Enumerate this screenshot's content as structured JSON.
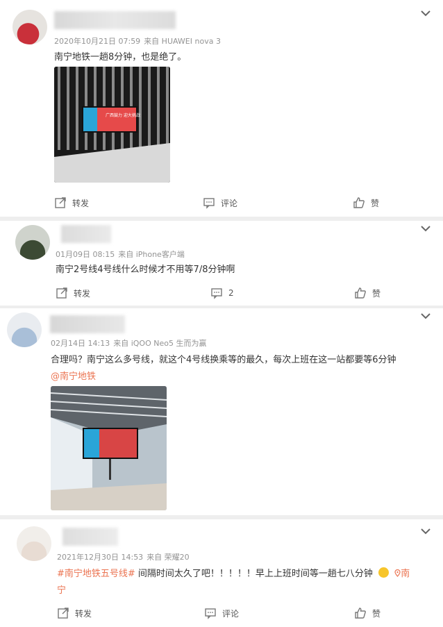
{
  "posts": [
    {
      "meta": {
        "time": "2020年10月21日 07:59",
        "source": "来自 HUAWEI nova 3"
      },
      "text": "南宁地铁一趟8分钟，也是绝了。",
      "image_screen_text": "广西鼓力 迎大挑战",
      "actions": {
        "repost": "转发",
        "comment": "评论",
        "like": "赞"
      }
    },
    {
      "meta": {
        "time": "01月09日 08:15",
        "source": "来自 iPhone客户端"
      },
      "text": "南宁2号线4号线什么时候才不用等7/8分钟啊",
      "actions": {
        "repost": "转发",
        "comment": "2",
        "like": "赞"
      }
    },
    {
      "meta": {
        "time": "02月14日 14:13",
        "source": "来自 iQOO Neo5 生而为赢"
      },
      "text": "合理吗？南宁这么多号线，就这个4号线换乘等的最久，每次上班在这一站都要等6分钟",
      "mention": "@南宁地铁"
    },
    {
      "meta": {
        "time": "2021年12月30日 14:53",
        "source": "来自 荣耀20"
      },
      "topic": "#南宁地铁五号线#",
      "text": " 间隔时间太久了吧！！！！！早上上班时间等一趟七八分钟",
      "location_a": "南",
      "location_b": "宁",
      "actions": {
        "repost": "转发",
        "comment": "评论",
        "like": "赞"
      }
    }
  ]
}
